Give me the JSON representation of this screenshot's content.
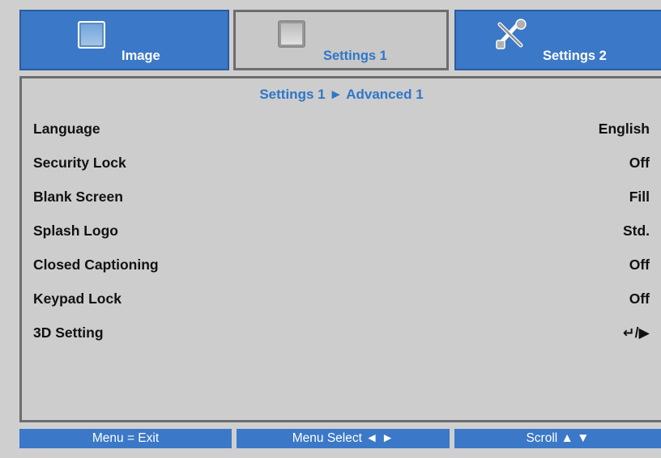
{
  "tabs": [
    {
      "label": "Image",
      "icon": "picture-icon",
      "active": false
    },
    {
      "label": "Settings 1",
      "icon": "picture-icon",
      "active": true
    },
    {
      "label": "Settings 2",
      "icon": "tools-icon",
      "active": false
    }
  ],
  "breadcrumb": "Settings 1 ► Advanced 1",
  "settings": [
    {
      "label": "Language",
      "value": "English"
    },
    {
      "label": "Security Lock",
      "value": "Off"
    },
    {
      "label": "Blank Screen",
      "value": "Fill"
    },
    {
      "label": "Splash Logo",
      "value": "Std."
    },
    {
      "label": "Closed Captioning",
      "value": "Off"
    },
    {
      "label": "Keypad Lock",
      "value": "Off"
    },
    {
      "label": "3D Setting",
      "value": "↵/▶"
    }
  ],
  "footer": {
    "exit": "Menu = Exit",
    "select": "Menu Select ◄ ►",
    "scroll": "Scroll ▲ ▼"
  },
  "colors": {
    "accent_blue": "#3b78c7",
    "label_blue": "#2f76c8",
    "panel_gray": "#cdcdcd",
    "border_gray": "#6d6d6d"
  }
}
